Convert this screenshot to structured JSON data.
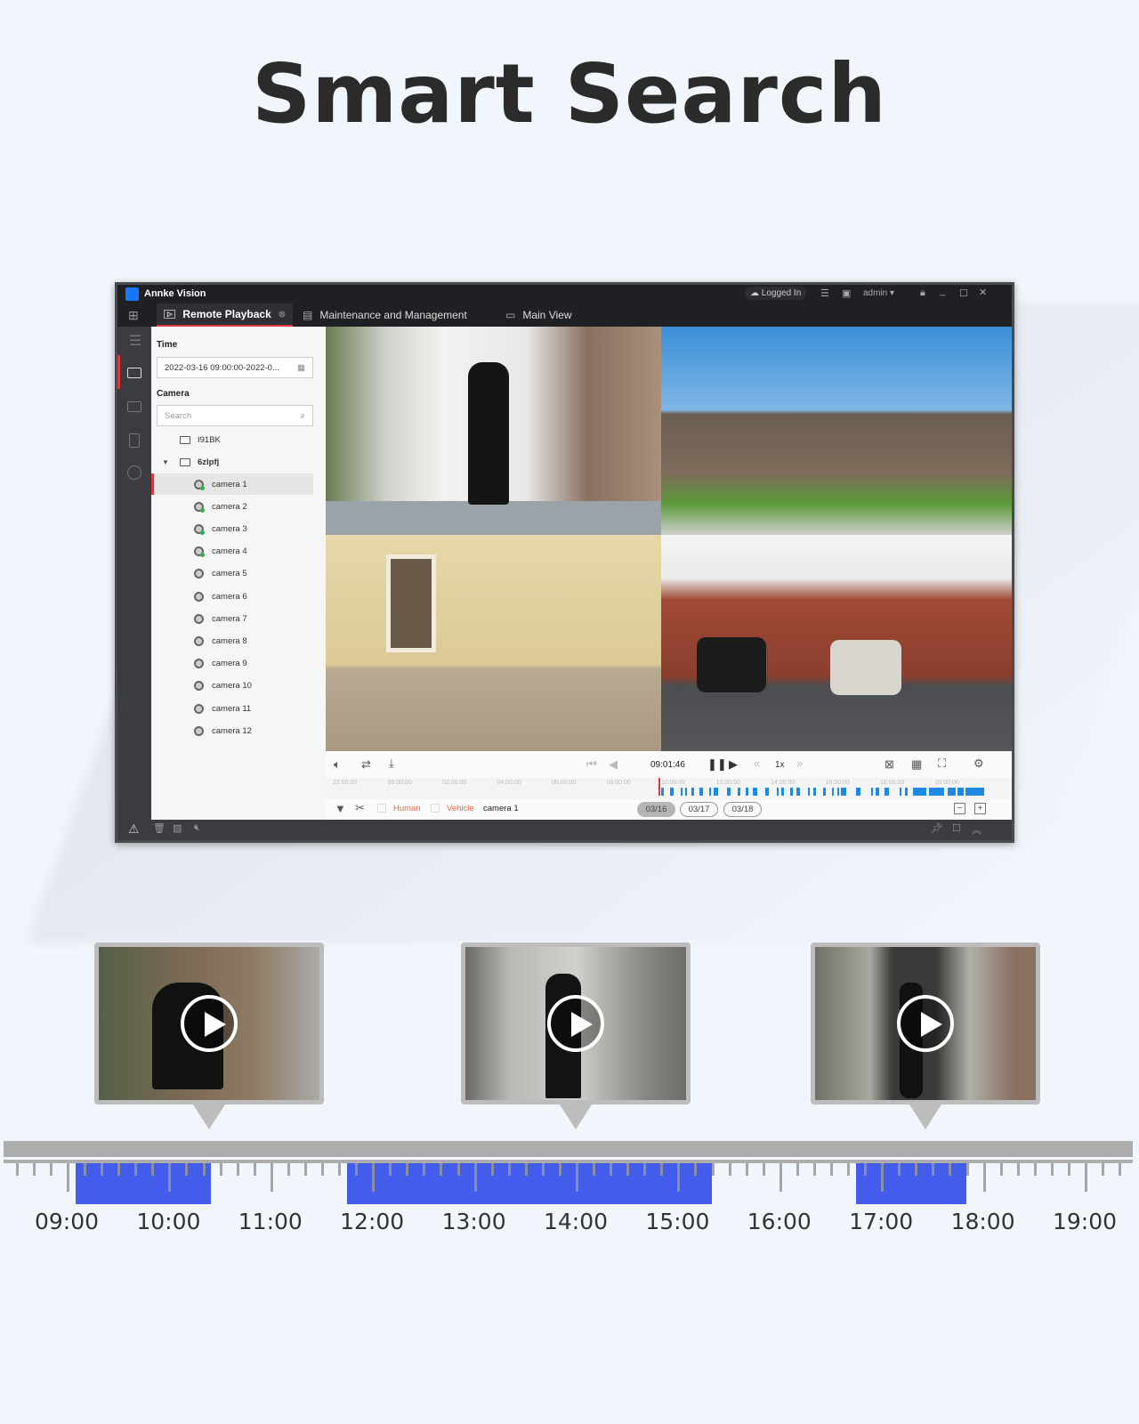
{
  "headline": "Smart Search",
  "app": {
    "title": "Annke Vision",
    "login_status": "Logged In",
    "user": "admin",
    "tabs": [
      {
        "label": "Remote Playback",
        "active": true
      },
      {
        "label": "Maintenance and Management"
      },
      {
        "label": "Main View"
      }
    ],
    "side": {
      "time_label": "Time",
      "time_value": "2022-03-16 09:00:00-2022-0...",
      "camera_label": "Camera",
      "search_placeholder": "Search",
      "groups": [
        {
          "name": "I91BK",
          "expanded": false
        },
        {
          "name": "6zlpfj",
          "expanded": true
        }
      ],
      "cameras": [
        {
          "name": "camera 1",
          "online": true,
          "selected": true
        },
        {
          "name": "camera 2",
          "online": true
        },
        {
          "name": "camera 3",
          "online": true
        },
        {
          "name": "camera 4",
          "online": true
        },
        {
          "name": "camera 5"
        },
        {
          "name": "camera 6"
        },
        {
          "name": "camera 7"
        },
        {
          "name": "camera 8"
        },
        {
          "name": "camera 9"
        },
        {
          "name": "camera 10"
        },
        {
          "name": "camera 11"
        },
        {
          "name": "camera 12"
        }
      ]
    },
    "playback": {
      "time": "09:01:46",
      "speed": "1x",
      "timeline_labels": [
        "22:00:00",
        "00:00:00",
        "02:00:00",
        "04:00:00",
        "06:00:00",
        "08:00:00",
        "10:00:00",
        "12:00:00",
        "14:00:00",
        "16:00:00",
        "18:00:00",
        "20:00:00"
      ],
      "filter_human": "Human",
      "filter_vehicle": "Vehicle",
      "selected_camera": "camera 1",
      "dates": [
        {
          "label": "03/16",
          "active": true
        },
        {
          "label": "03/17"
        },
        {
          "label": "03/18"
        }
      ]
    },
    "colors": {
      "accent": "#d9363e",
      "record": "#1e88e5",
      "titlebar": "#1f2023"
    }
  },
  "timeline": {
    "labels": [
      "09:00",
      "10:00",
      "11:00",
      "12:00",
      "13:00",
      "14:00",
      "15:00",
      "16:00",
      "17:00",
      "18:00",
      "19:00"
    ],
    "events": [
      [
        "09:05",
        "10:25"
      ],
      [
        "11:45",
        "15:20"
      ],
      [
        "16:45",
        "17:50"
      ]
    ],
    "event_color": "#435ceb"
  }
}
